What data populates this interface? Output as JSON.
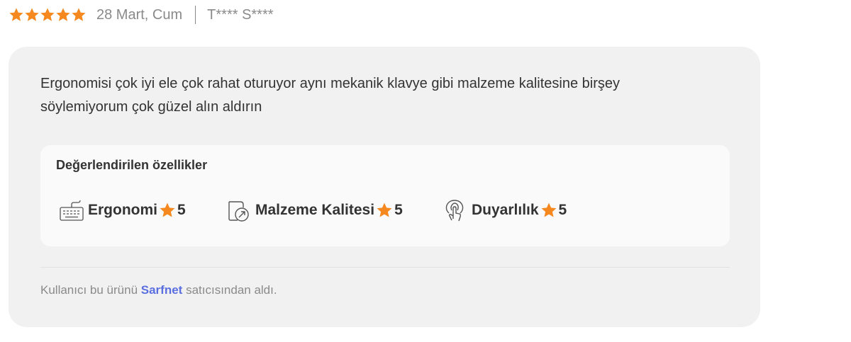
{
  "review": {
    "rating": 5,
    "rating_max": 5,
    "date": "28 Mart, Cum",
    "author": "T**** S****",
    "text": "Ergonomisi çok iyi ele çok rahat oturuyor aynı mekanik klavye gibi malzeme kalitesine birşey söylemiyorum çok güzel alın aldırın"
  },
  "features": {
    "title": "Değerlendirilen özellikler",
    "items": [
      {
        "icon": "keyboard-icon",
        "label": "Ergonomi",
        "score": "5"
      },
      {
        "icon": "material-quality-icon",
        "label": "Malzeme Kalitesi",
        "score": "5"
      },
      {
        "icon": "touch-icon",
        "label": "Duyarlılık",
        "score": "5"
      }
    ]
  },
  "seller": {
    "prefix": "Kullanıcı bu ürünü ",
    "name": "Sarfnet",
    "suffix": " satıcısından aldı."
  },
  "colors": {
    "star": "#f5891f",
    "card_background": "#f1f1f1",
    "panel_background": "#fafafa",
    "seller_link": "#5b6fe0",
    "muted_text": "#8a8a8a",
    "body_text": "#333333"
  }
}
